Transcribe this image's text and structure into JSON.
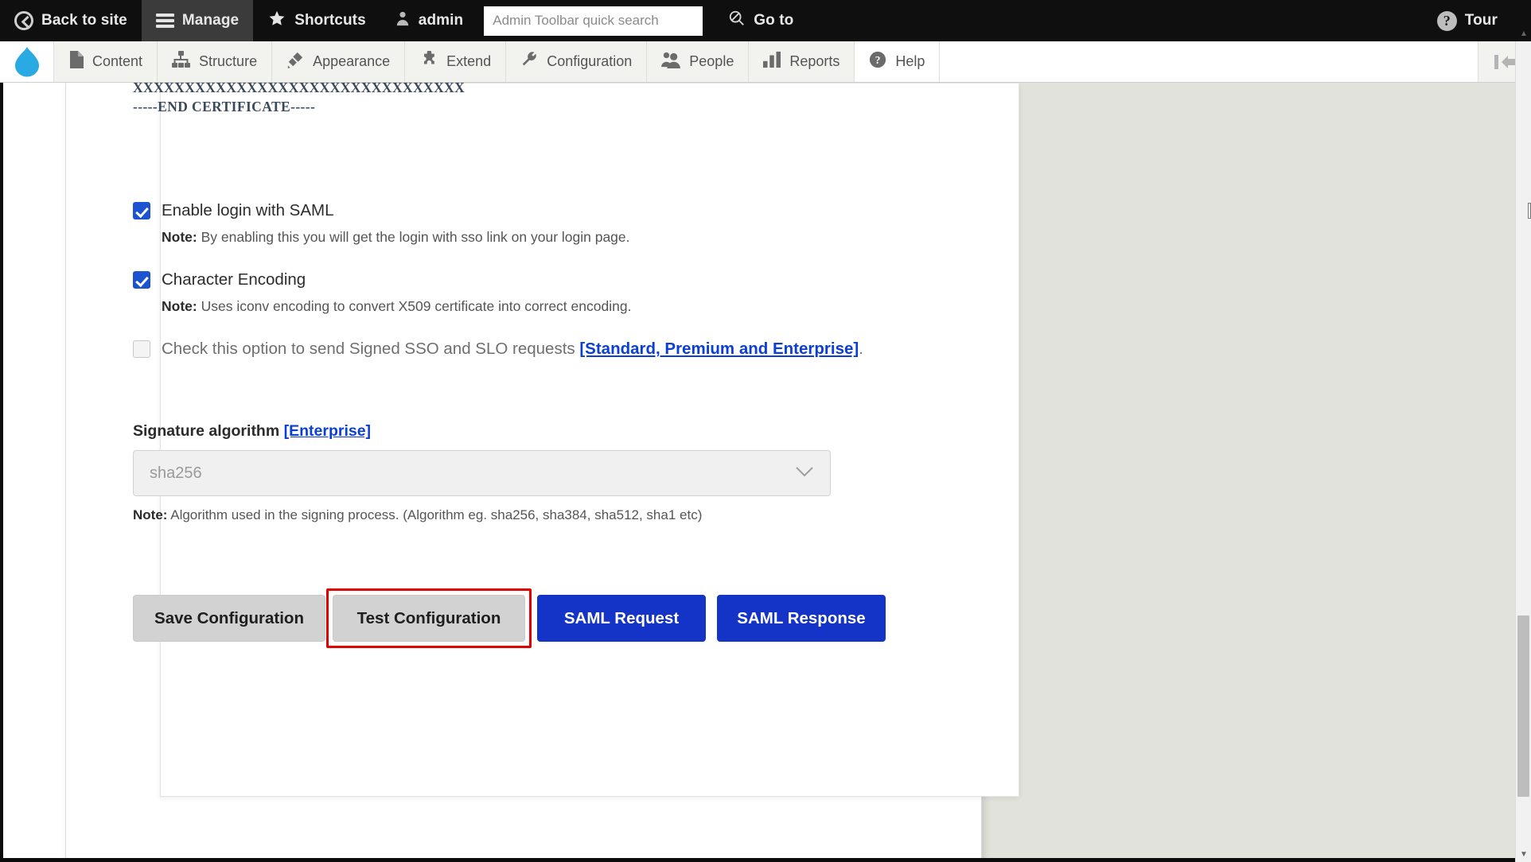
{
  "admin_toolbar": {
    "back_to_site": "Back to site",
    "manage": "Manage",
    "shortcuts": "Shortcuts",
    "user": "admin",
    "search_placeholder": "Admin Toolbar quick search",
    "search_value": "",
    "go_to": "Go to",
    "tour": "Tour"
  },
  "menu_bar": {
    "items": [
      {
        "label": "Content",
        "icon": "page-icon"
      },
      {
        "label": "Structure",
        "icon": "structure-icon"
      },
      {
        "label": "Appearance",
        "icon": "brush-icon"
      },
      {
        "label": "Extend",
        "icon": "puzzle-icon"
      },
      {
        "label": "Configuration",
        "icon": "wrench-icon"
      },
      {
        "label": "People",
        "icon": "people-icon"
      },
      {
        "label": "Reports",
        "icon": "bar-chart-icon"
      },
      {
        "label": "Help",
        "icon": "question-circle-icon"
      }
    ]
  },
  "form": {
    "certificate": {
      "masked_line": "XXXXXXXXXXXXXXXXXXXXXXXXXXXXXXXX",
      "end_line": "-----END CERTIFICATE-----"
    },
    "enable_saml": {
      "label": "Enable login with SAML",
      "checked": true,
      "note_prefix": "Note:",
      "note_text": " By enabling this you will get the login with sso link on your login page."
    },
    "character_encoding": {
      "label": "Character Encoding",
      "checked": true,
      "note_prefix": "Note:",
      "note_text": " Uses iconv encoding to convert X509 certificate into correct encoding."
    },
    "signed_requests": {
      "label": "Check this option to send Signed SSO and SLO requests ",
      "link": "[Standard, Premium and Enterprise]",
      "suffix": ".",
      "checked": false
    },
    "signature_algorithm": {
      "label": "Signature algorithm ",
      "label_link": "[Enterprise]",
      "value": "sha256",
      "note_prefix": "Note:",
      "note_text": " Algorithm used in the signing process. (Algorithm eg. sha256, sha384, sha512, sha1 etc)"
    },
    "buttons": {
      "save": "Save Configuration",
      "test": "Test Configuration",
      "saml_request": "SAML Request",
      "saml_response": "SAML Response"
    }
  },
  "colors": {
    "toolbar_bg": "#0f0f0f",
    "menu_bg": "#f2f2ef",
    "primary_blue": "#1434c8",
    "checkbox_blue": "#1b53d0",
    "link_blue": "#0b3fd4",
    "highlight_red": "#e10000",
    "gray_button": "#d2d2d2",
    "page_gray": "#e2e2dc"
  }
}
